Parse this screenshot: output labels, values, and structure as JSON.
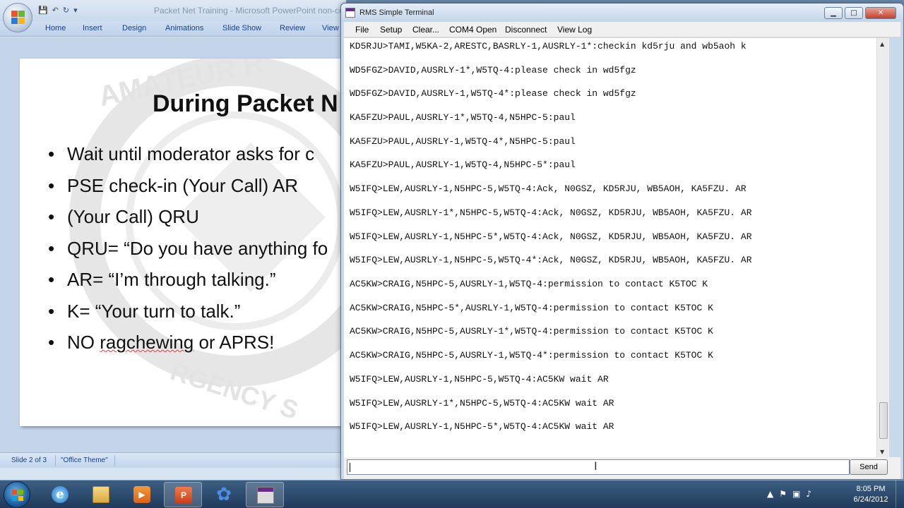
{
  "powerpoint": {
    "window_title": "Packet Net Training - Microsoft PowerPoint non-cor",
    "tabs": [
      "Home",
      "Insert",
      "Design",
      "Animations",
      "Slide Show",
      "Review",
      "View"
    ],
    "slide": {
      "title": "During Packet N",
      "bullets": [
        "Wait until moderator asks for c",
        "PSE check-in (Your Call) AR",
        "(Your Call) QRU",
        "QRU= “Do you have anything fo",
        "AR= “I’m through talking.”",
        "K= “Your turn to talk.”",
        "NO ragchewing or APRS!"
      ],
      "squiggle_word": "ragchewing"
    },
    "status": {
      "slide_indicator": "Slide 2 of 3",
      "theme": "\"Office Theme\""
    }
  },
  "terminal": {
    "window_title": "RMS Simple Terminal",
    "menu": [
      "File",
      "Setup",
      "Clear...",
      "COM4 Open",
      "Disconnect",
      "View Log"
    ],
    "lines": [
      "KD5RJU>TAMI,W5KA-2,ARESTC,BASRLY-1,AUSRLY-1*:checkin kd5rju and wb5aoh k",
      "WD5FGZ>DAVID,AUSRLY-1*,W5TQ-4:please check in wd5fgz",
      "WD5FGZ>DAVID,AUSRLY-1,W5TQ-4*:please check in wd5fgz",
      "KA5FZU>PAUL,AUSRLY-1*,W5TQ-4,N5HPC-5:paul",
      "KA5FZU>PAUL,AUSRLY-1,W5TQ-4*,N5HPC-5:paul",
      "KA5FZU>PAUL,AUSRLY-1,W5TQ-4,N5HPC-5*:paul",
      "W5IFQ>LEW,AUSRLY-1,N5HPC-5,W5TQ-4:Ack, N0GSZ, KD5RJU, WB5AOH, KA5FZU. AR",
      "W5IFQ>LEW,AUSRLY-1*,N5HPC-5,W5TQ-4:Ack, N0GSZ, KD5RJU, WB5AOH, KA5FZU. AR",
      "W5IFQ>LEW,AUSRLY-1,N5HPC-5*,W5TQ-4:Ack, N0GSZ, KD5RJU, WB5AOH, KA5FZU. AR",
      "W5IFQ>LEW,AUSRLY-1,N5HPC-5,W5TQ-4*:Ack, N0GSZ, KD5RJU, WB5AOH, KA5FZU. AR",
      "AC5KW>CRAIG,N5HPC-5,AUSRLY-1,W5TQ-4:permission to contact K5TOC K",
      "AC5KW>CRAIG,N5HPC-5*,AUSRLY-1,W5TQ-4:permission to contact K5TOC K",
      "AC5KW>CRAIG,N5HPC-5,AUSRLY-1*,W5TQ-4:permission to contact K5TOC K",
      "AC5KW>CRAIG,N5HPC-5,AUSRLY-1,W5TQ-4*:permission to contact K5TOC K",
      "W5IFQ>LEW,AUSRLY-1,N5HPC-5,W5TQ-4:AC5KW wait AR",
      "W5IFQ>LEW,AUSRLY-1*,N5HPC-5,W5TQ-4:AC5KW wait AR",
      "W5IFQ>LEW,AUSRLY-1,N5HPC-5*,W5TQ-4:AC5KW wait AR"
    ],
    "input": {
      "value": "",
      "placeholder": ""
    },
    "send_label": "Send"
  },
  "taskbar": {
    "apps": [
      "start-button",
      "internet-explorer",
      "file-explorer",
      "media-player",
      "powerpoint",
      "flower-app",
      "rms-terminal"
    ],
    "time": "8:05 PM",
    "date": "6/24/2012"
  },
  "colors": {
    "terminal_bg": "#ffffff",
    "chrome_blue": "#c9d9ec",
    "ribbon_text": "#15428b",
    "close_red": "#c4402c"
  }
}
